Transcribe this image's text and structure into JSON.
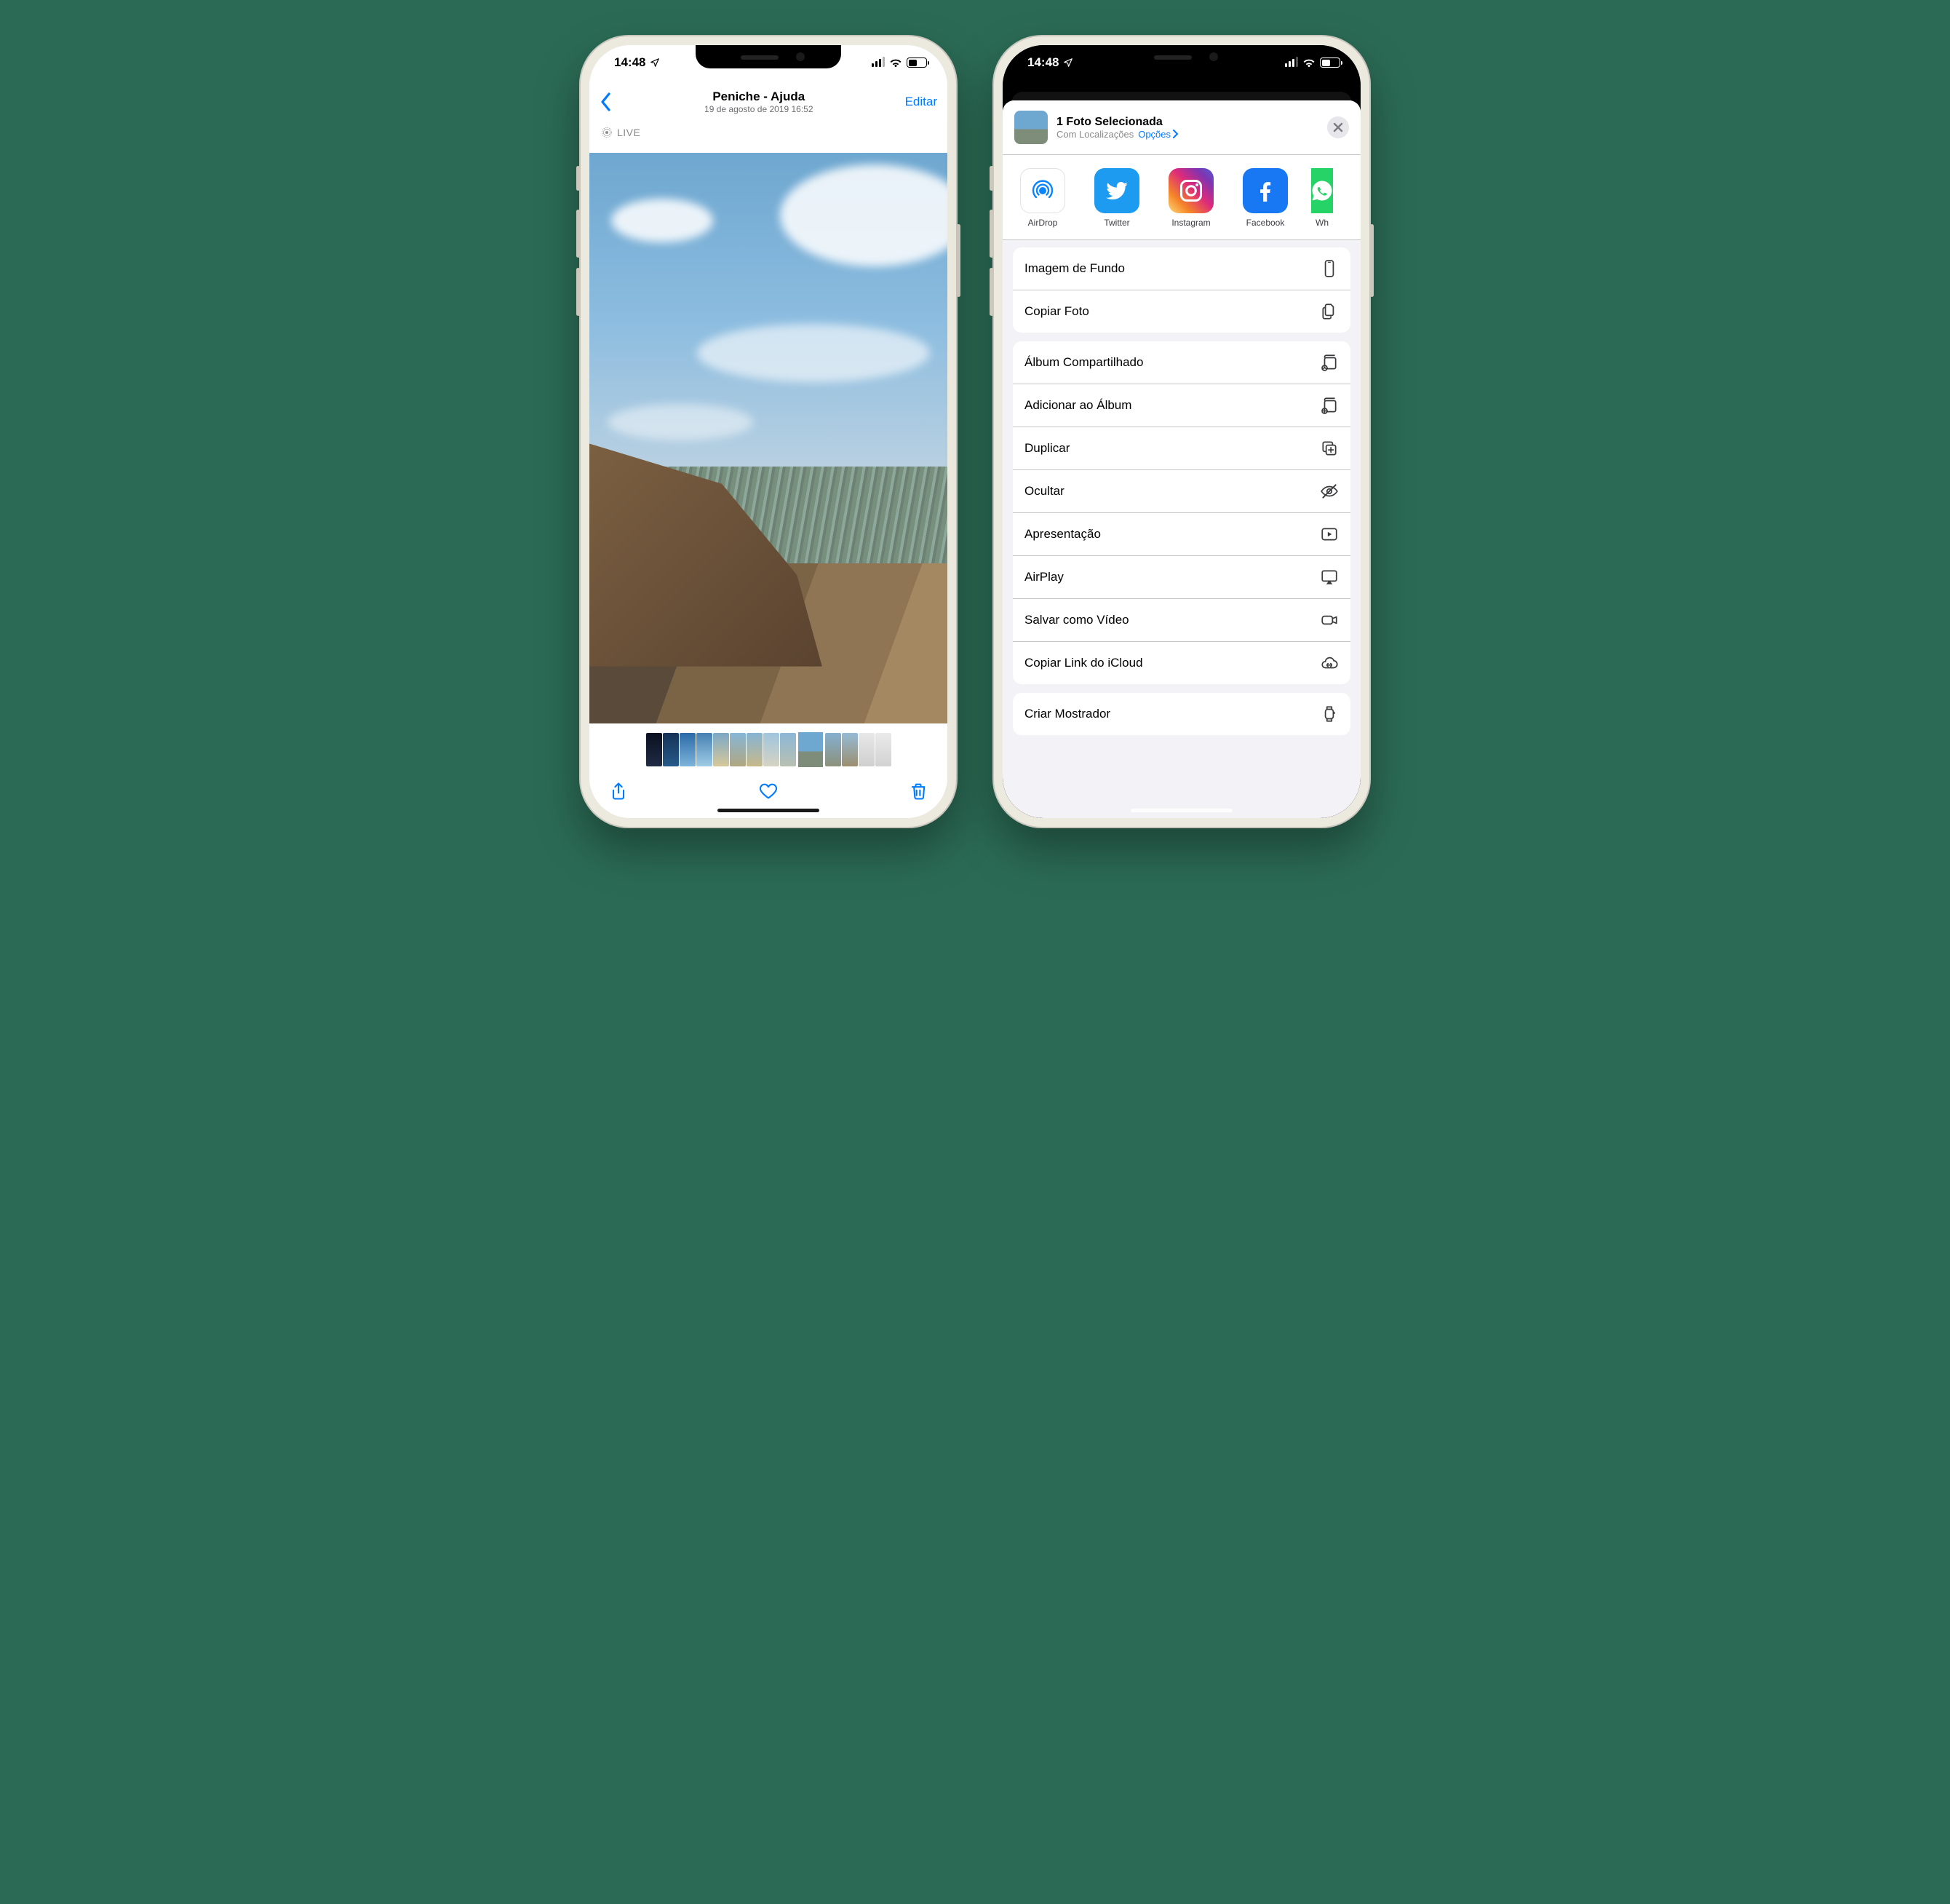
{
  "status": {
    "time": "14:48"
  },
  "photo": {
    "nav_title": "Peniche - Ajuda",
    "nav_subtitle": "19 de agosto de 2019  16:52",
    "edit": "Editar",
    "live": "LIVE"
  },
  "share": {
    "title": "1 Foto Selecionada",
    "subtitle": "Com Localizações",
    "options": "Opções",
    "apps": {
      "airdrop": "AirDrop",
      "twitter": "Twitter",
      "instagram": "Instagram",
      "facebook": "Facebook",
      "whatsapp": "Wh"
    },
    "group1": {
      "wallpaper": "Imagem de Fundo",
      "copy": "Copiar Foto"
    },
    "group2": {
      "shared_album": "Álbum Compartilhado",
      "add_album": "Adicionar ao Álbum",
      "duplicate": "Duplicar",
      "hide": "Ocultar",
      "slideshow": "Apresentação",
      "airplay": "AirPlay",
      "save_video": "Salvar como Vídeo",
      "icloud_link": "Copiar Link do iCloud"
    },
    "group3": {
      "watch_face": "Criar Mostrador"
    }
  }
}
